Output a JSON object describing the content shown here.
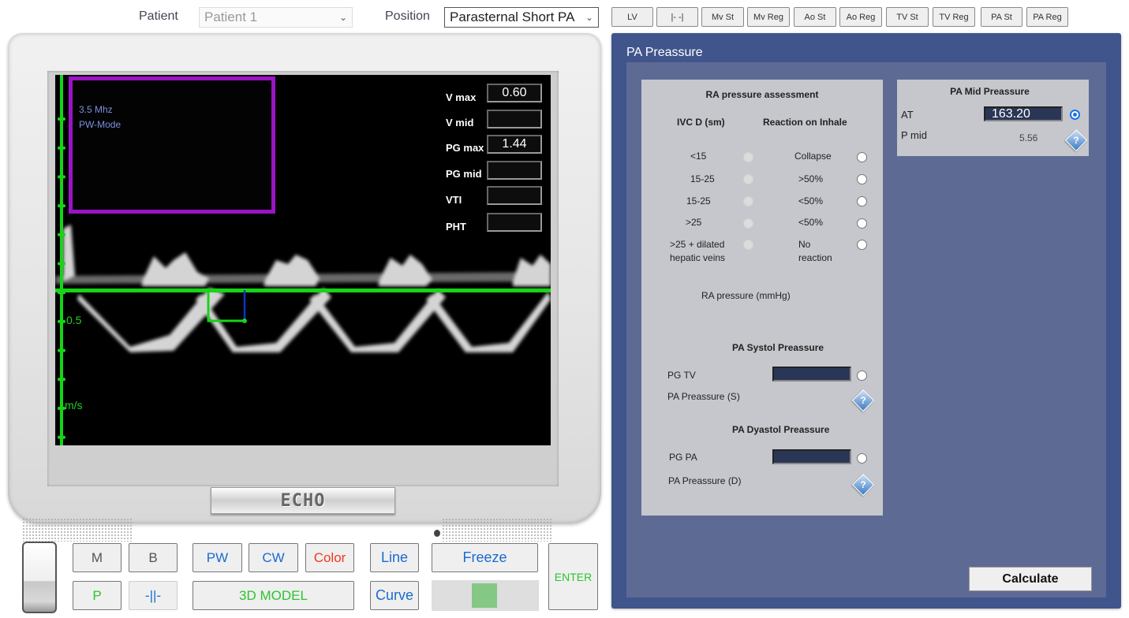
{
  "topbar": {
    "patient_label": "Patient",
    "patient_value": "Patient 1",
    "position_label": "Position",
    "position_value": "Parasternal Short PA",
    "view_buttons": [
      "LV",
      "|- -|",
      "Mv St",
      "Mv Reg",
      "Ao St",
      "Ao Reg",
      "TV St",
      "TV Reg",
      "PA St",
      "PA Reg"
    ]
  },
  "monitor": {
    "brand": "ECHO",
    "frequency": "3.5 Mhz",
    "mode": "PW-Mode",
    "axis_tick_label": "0.5",
    "axis_unit": "m/s",
    "measurements": [
      {
        "label": "V max",
        "value": "0.60"
      },
      {
        "label": "V mid",
        "value": ""
      },
      {
        "label": "PG max",
        "value": "1.44"
      },
      {
        "label": "PG mid",
        "value": ""
      },
      {
        "label": "VTI",
        "value": ""
      },
      {
        "label": "PHT",
        "value": ""
      }
    ]
  },
  "controls": {
    "m": "M",
    "b": "B",
    "pw": "PW",
    "cw": "CW",
    "color": "Color",
    "p": "P",
    "split": "-||-",
    "model3d": "3D MODEL",
    "line": "Line",
    "curve": "Curve",
    "freeze": "Freeze",
    "enter": "ENTER",
    "slider_fraction": 0.5
  },
  "panel": {
    "title": "PA Preassure",
    "ra": {
      "title": "RA pressure assessment",
      "col1": "IVC D (sm)",
      "col2": "Reaction on Inhale",
      "rows": [
        {
          "ivc": "<15",
          "reaction": "Collapse"
        },
        {
          "ivc": "15-25",
          "reaction": ">50%"
        },
        {
          "ivc": "15-25",
          "reaction": "<50%"
        },
        {
          "ivc": ">25",
          "reaction": "<50%"
        },
        {
          "ivc": ">25 + dilated hepatic veins",
          "reaction": "No reaction"
        }
      ],
      "result_label": "RA pressure (mmHg)"
    },
    "systol": {
      "title": "PA Systol Preassure",
      "pg_label": "PG TV",
      "pg_value": "",
      "result_label": "PA Preassure (S)"
    },
    "dyastol": {
      "title": "PA Dyastol Preassure",
      "pg_label": "PG PA",
      "pg_value": "",
      "result_label": "PA Preassure (D)"
    },
    "mid": {
      "title": "PA Mid Preassure",
      "at_label": "AT",
      "at_value": "163.20",
      "pmid_label": "P mid",
      "pmid_value": "5.56"
    },
    "help_glyph": "?",
    "calculate": "Calculate"
  }
}
